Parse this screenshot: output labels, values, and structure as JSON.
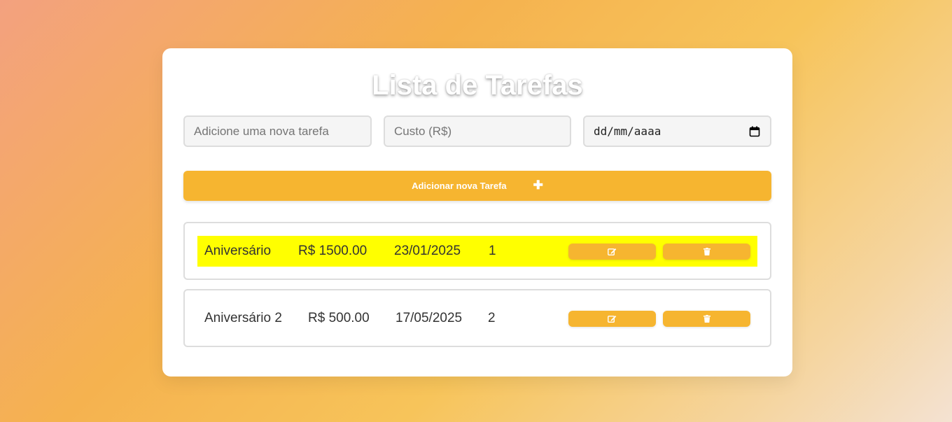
{
  "page": {
    "title": "Lista de Tarefas"
  },
  "form": {
    "task_placeholder": "Adicione uma nova tarefa",
    "cost_placeholder": "Custo (R$)",
    "date_placeholder": "dd/mm/aaaa",
    "add_button_label": "Adicionar nova Tarefa",
    "add_button_icon": "plus-icon"
  },
  "tasks": [
    {
      "name": "Aniversário",
      "cost": "R$ 1500.00",
      "date": "23/01/2025",
      "order": "1",
      "highlighted": true,
      "edit_icon": "edit-icon",
      "delete_icon": "trash-icon"
    },
    {
      "name": "Aniversário 2",
      "cost": "R$ 500.00",
      "date": "17/05/2025",
      "order": "2",
      "highlighted": false,
      "edit_icon": "edit-icon",
      "delete_icon": "trash-icon"
    }
  ],
  "colors": {
    "accent": "#f6b530",
    "highlight": "#ffff00",
    "card": "#ffffff",
    "text": "#333333"
  }
}
